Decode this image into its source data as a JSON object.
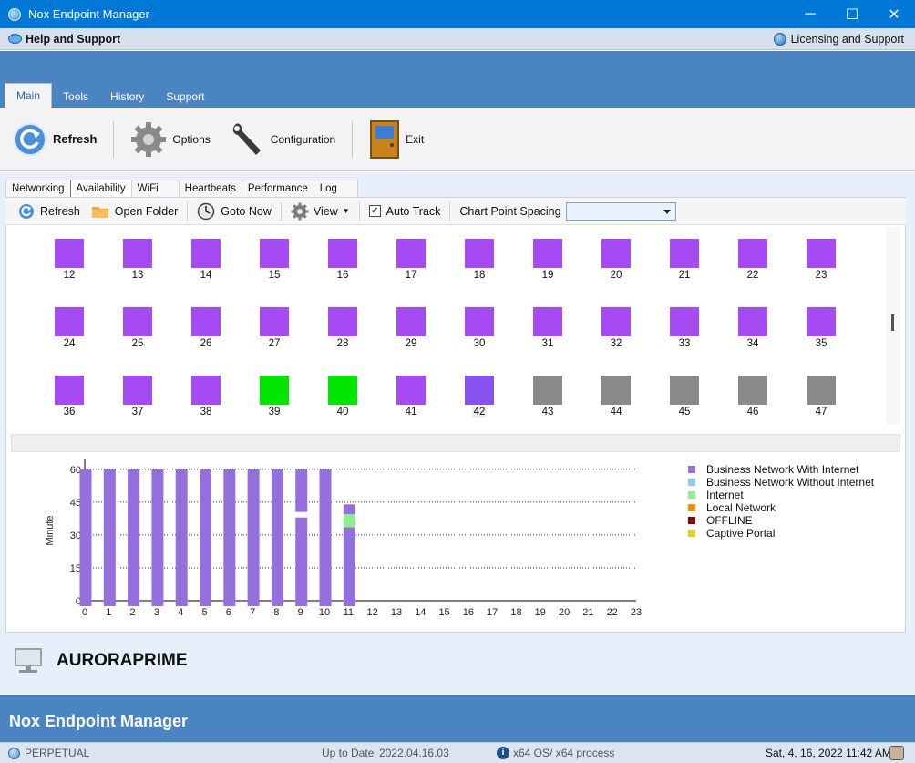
{
  "window": {
    "title": "Nox Endpoint Manager",
    "minimize": "─",
    "maximize": "☐",
    "close": "✕"
  },
  "helpbar": {
    "left_label": "Help and Support",
    "right_label": "Licensing and Support"
  },
  "ribbon_tabs": [
    "Main",
    "Tools",
    "History",
    "Support"
  ],
  "ribbon": {
    "refresh": "Refresh",
    "options": "Options",
    "configuration": "Configuration",
    "exit": "Exit"
  },
  "inner_tabs": [
    "Networking",
    "Availability",
    "WiFi",
    "Heartbeats",
    "Performance",
    "Log"
  ],
  "toolbar": {
    "refresh": "Refresh",
    "open_folder": "Open Folder",
    "goto_now": "Goto Now",
    "view": "View",
    "auto_track": "Auto Track",
    "auto_track_checked": true,
    "chart_point_spacing": "Chart Point Spacing",
    "spacing_value": ""
  },
  "colors": {
    "purple": "#a64bf4",
    "green": "#00e600",
    "blue_violet": "#8752f0",
    "gray": "#8a8a8a",
    "bar_purple": "#9370db",
    "bar_green": "#90ee90",
    "brand_blue": "#4a85c2"
  },
  "grid_rows": [
    {
      "items": [
        {
          "n": "12",
          "c": "purple"
        },
        {
          "n": "13",
          "c": "purple"
        },
        {
          "n": "14",
          "c": "purple"
        },
        {
          "n": "15",
          "c": "purple"
        },
        {
          "n": "16",
          "c": "purple"
        },
        {
          "n": "17",
          "c": "purple"
        },
        {
          "n": "18",
          "c": "purple"
        },
        {
          "n": "19",
          "c": "purple"
        },
        {
          "n": "20",
          "c": "purple"
        },
        {
          "n": "21",
          "c": "purple"
        },
        {
          "n": "22",
          "c": "purple"
        },
        {
          "n": "23",
          "c": "purple"
        }
      ]
    },
    {
      "items": [
        {
          "n": "24",
          "c": "purple"
        },
        {
          "n": "25",
          "c": "purple"
        },
        {
          "n": "26",
          "c": "purple"
        },
        {
          "n": "27",
          "c": "purple"
        },
        {
          "n": "28",
          "c": "purple"
        },
        {
          "n": "29",
          "c": "purple"
        },
        {
          "n": "30",
          "c": "purple"
        },
        {
          "n": "31",
          "c": "purple"
        },
        {
          "n": "32",
          "c": "purple"
        },
        {
          "n": "33",
          "c": "purple"
        },
        {
          "n": "34",
          "c": "purple"
        },
        {
          "n": "35",
          "c": "purple"
        }
      ]
    },
    {
      "items": [
        {
          "n": "36",
          "c": "purple"
        },
        {
          "n": "37",
          "c": "purple"
        },
        {
          "n": "38",
          "c": "purple"
        },
        {
          "n": "39",
          "c": "green"
        },
        {
          "n": "40",
          "c": "green"
        },
        {
          "n": "41",
          "c": "purple"
        },
        {
          "n": "42",
          "c": "blue_violet",
          "selected": true
        },
        {
          "n": "43",
          "c": "gray"
        },
        {
          "n": "44",
          "c": "gray"
        },
        {
          "n": "45",
          "c": "gray"
        },
        {
          "n": "46",
          "c": "gray"
        },
        {
          "n": "47",
          "c": "gray"
        }
      ]
    }
  ],
  "chart_data": {
    "type": "bar",
    "title": "",
    "xlabel": "",
    "ylabel": "Minute",
    "x": [
      0,
      1,
      2,
      3,
      4,
      5,
      6,
      7,
      8,
      9,
      10,
      11,
      12,
      13,
      14,
      15,
      16,
      17,
      18,
      19,
      20,
      21,
      22,
      23
    ],
    "yticks": [
      0,
      15,
      30,
      45,
      60
    ],
    "ylim": [
      0,
      62
    ],
    "grid": "horizontal dotted",
    "stacked": true,
    "bars": [
      {
        "x": 0,
        "segments": [
          {
            "s": "Business Network With Internet",
            "from": 0,
            "to": 60
          }
        ]
      },
      {
        "x": 1,
        "segments": [
          {
            "s": "Business Network With Internet",
            "from": 0,
            "to": 60
          }
        ]
      },
      {
        "x": 2,
        "segments": [
          {
            "s": "Business Network With Internet",
            "from": 0,
            "to": 60
          }
        ]
      },
      {
        "x": 3,
        "segments": [
          {
            "s": "Business Network With Internet",
            "from": 0,
            "to": 60
          }
        ]
      },
      {
        "x": 4,
        "segments": [
          {
            "s": "Business Network With Internet",
            "from": 0,
            "to": 60
          }
        ]
      },
      {
        "x": 5,
        "segments": [
          {
            "s": "Business Network With Internet",
            "from": 0,
            "to": 60
          }
        ]
      },
      {
        "x": 6,
        "segments": [
          {
            "s": "Business Network With Internet",
            "from": 0,
            "to": 60
          }
        ]
      },
      {
        "x": 7,
        "segments": [
          {
            "s": "Business Network With Internet",
            "from": 0,
            "to": 60
          }
        ]
      },
      {
        "x": 8,
        "segments": [
          {
            "s": "Business Network With Internet",
            "from": 0,
            "to": 60
          }
        ]
      },
      {
        "x": 9,
        "segments": [
          {
            "s": "Business Network With Internet",
            "from": 0,
            "to": 38
          },
          {
            "s": "Business Network With Internet",
            "from": 43,
            "to": 60
          }
        ]
      },
      {
        "x": 10,
        "segments": [
          {
            "s": "Business Network With Internet",
            "from": 0,
            "to": 60
          }
        ]
      },
      {
        "x": 11,
        "segments": [
          {
            "s": "Business Network With Internet",
            "from": 0,
            "to": 36
          },
          {
            "s": "Internet",
            "from": 36,
            "to": 42
          },
          {
            "s": "Business Network With Internet",
            "from": 42,
            "to": 44
          }
        ]
      }
    ],
    "legend": [
      {
        "name": "Business Network With Internet",
        "color": "#9370db"
      },
      {
        "name": "Business Network Without Internet",
        "color": "#87ceeb"
      },
      {
        "name": "Internet",
        "color": "#90ee90"
      },
      {
        "name": "Local Network",
        "color": "#ff8c00"
      },
      {
        "name": "OFFLINE",
        "color": "#8b0000"
      },
      {
        "name": "Captive Portal",
        "color": "#e0d020"
      }
    ],
    "legend_position": "right"
  },
  "machine": {
    "name": "AURORAPRIME"
  },
  "brand": {
    "title": "Nox Endpoint Manager"
  },
  "status": {
    "license": "PERPETUAL",
    "update_link": "Up to Date",
    "version": "2022.04.16.03",
    "arch": "x64 OS/ x64 process",
    "datetime": "Sat, 4, 16, 2022 11:42 AM"
  }
}
